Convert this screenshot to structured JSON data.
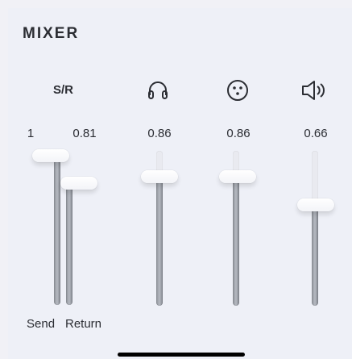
{
  "mixer": {
    "title": "MIXER",
    "sr_label": "S/R",
    "channels": {
      "send": {
        "label": "Send",
        "value": "1"
      },
      "return": {
        "label": "Return",
        "value": "0.81"
      },
      "headphones": {
        "icon": "headphones-icon",
        "value": "0.86"
      },
      "xlr": {
        "icon": "xlr-connector-icon",
        "value": "0.86"
      },
      "speaker": {
        "icon": "speaker-icon",
        "value": "0.66"
      }
    }
  }
}
